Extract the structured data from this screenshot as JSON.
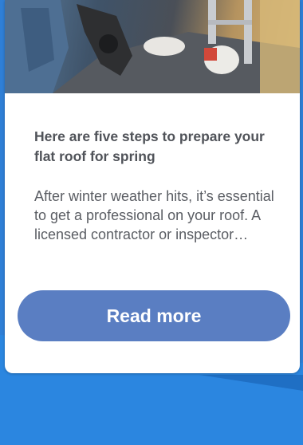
{
  "card": {
    "image_alt": "Roofers working on a flat roof",
    "title": "Here are five steps to prepare your flat roof for spring",
    "excerpt": "After winter weather hits, it’s essential to get a professional on your roof. A licensed contractor or inspector…",
    "button_label": "Read more"
  },
  "colors": {
    "page_background": "#2f7fd6",
    "button": "#5a7ec2"
  }
}
